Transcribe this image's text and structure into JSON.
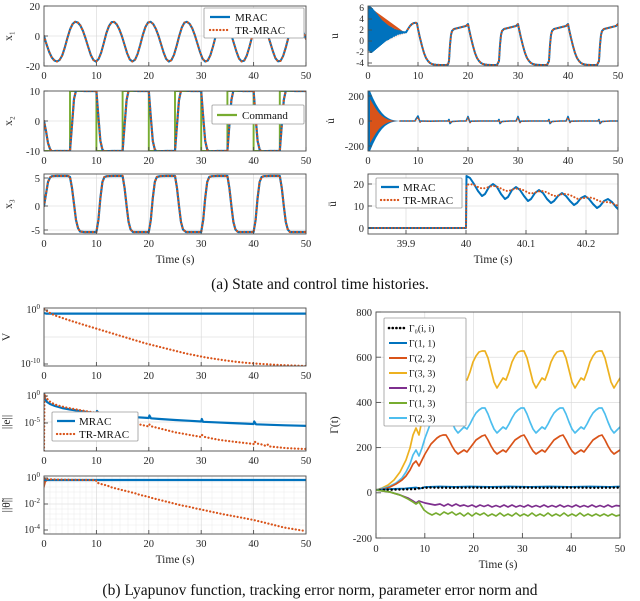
{
  "figure": {
    "caption_a": "(a) State and control time histories.",
    "caption_b": "(b) Lyapunov function, tracking error norm, parameter error norm and"
  },
  "colors": {
    "mrac_blue": "#0072BD",
    "trmrac_orange": "#D95319",
    "command_green": "#77AC30",
    "yellow": "#EDB120",
    "purple": "#7E2F8E",
    "green": "#77AC30",
    "lightblue": "#4DBEEE",
    "black": "#000000",
    "axis": "#4d4d4d",
    "grid": "#d6d6d6"
  },
  "legends": {
    "mrac": "MRAC",
    "trmrac": "TR-MRAC",
    "command": "Command",
    "gamma0": "Γ₀(i, i)",
    "g11": "Γ(1, 1)",
    "g22": "Γ(2, 2)",
    "g33": "Γ(3, 3)",
    "g12": "Γ(1, 2)",
    "g13": "Γ(1, 3)",
    "g23": "Γ(2, 3)"
  },
  "axis_labels": {
    "time": "Time (s)",
    "x1": "x₁",
    "x2": "x₂",
    "x3": "x₃",
    "u": "u",
    "udot": "u̇",
    "uddot": "ü",
    "V": "V",
    "enorm": "||e||",
    "thetanorm": "||θ̃||",
    "gamma_t": "Γ(t)"
  },
  "chart_data": [
    {
      "id": "x1",
      "type": "line",
      "title": "",
      "xlabel": "",
      "ylabel": "x1",
      "xlim": [
        0,
        50
      ],
      "ylim": [
        -20,
        20
      ],
      "xticks": [
        0,
        10,
        20,
        30,
        40,
        50
      ],
      "yticks": [
        -20,
        0,
        20
      ],
      "grid": true,
      "legend": [
        "MRAC",
        "TR-MRAC"
      ],
      "legend_position": "top-right",
      "series": [
        {
          "name": "MRAC",
          "color": "#0072BD",
          "style": "solid",
          "x": [
            0,
            1,
            2,
            3,
            4,
            5,
            6,
            7,
            8,
            9,
            10,
            11,
            12,
            13,
            14,
            15,
            16,
            17,
            18,
            19,
            20,
            21,
            22,
            23,
            24,
            25,
            26,
            27,
            28,
            29,
            30,
            31,
            32,
            33,
            34,
            35,
            36,
            37,
            38,
            39,
            40,
            41,
            42,
            43,
            44,
            45,
            46,
            47,
            48,
            49,
            50
          ],
          "y": [
            0,
            -6,
            -11,
            -14,
            -15,
            -15,
            -12,
            -5,
            4,
            11,
            13.5,
            12,
            8,
            2,
            -6,
            -13.5,
            -14.5,
            -12.5,
            -8,
            -1,
            12,
            13,
            11,
            6,
            -2,
            -11,
            -14.5,
            -14,
            -10,
            -4,
            13,
            13.5,
            12,
            8,
            1.5,
            -12,
            -14,
            -13.5,
            -11,
            -5.5,
            1,
            12.5,
            13,
            12,
            8,
            -11.5,
            -14,
            -13.5,
            -12,
            -7,
            12
          ]
        },
        {
          "name": "TR-MRAC",
          "color": "#D95319",
          "style": "dotted",
          "x": [
            0,
            1,
            2,
            3,
            4,
            5,
            6,
            7,
            8,
            9,
            10,
            11,
            12,
            13,
            14,
            15,
            16,
            17,
            18,
            19,
            20,
            21,
            22,
            23,
            24,
            25,
            26,
            27,
            28,
            29,
            30,
            31,
            32,
            33,
            34,
            35,
            36,
            37,
            38,
            39,
            40,
            41,
            42,
            43,
            44,
            45,
            46,
            47,
            48,
            49,
            50
          ],
          "y": [
            0,
            -6,
            -11,
            -14,
            -15,
            -15,
            -12,
            -5,
            4,
            11,
            13.5,
            12,
            8,
            2,
            -6,
            -13.5,
            -14.5,
            -12.5,
            -8,
            -1,
            12,
            13,
            11,
            6,
            -2,
            -11,
            -14.5,
            -14,
            -10,
            -4,
            13,
            13.5,
            12,
            8,
            1.5,
            -12,
            -14,
            -13.5,
            -11,
            -5.5,
            1,
            12.5,
            13,
            12,
            8,
            -11.5,
            -14,
            -13.5,
            -12,
            -7,
            12
          ]
        }
      ]
    },
    {
      "id": "x2",
      "type": "line",
      "ylabel": "x2",
      "xlim": [
        0,
        50
      ],
      "ylim": [
        -10,
        10
      ],
      "xticks": [
        0,
        10,
        20,
        30,
        40,
        50
      ],
      "yticks": [
        -10,
        0,
        10
      ],
      "grid": true,
      "legend": [
        "Command"
      ],
      "legend_position": "right",
      "description": "square-wave command between -10 and +10 with 5 s half period; MRAC and TR-MRAC track it with slight rounding."
    },
    {
      "id": "x3",
      "type": "line",
      "ylabel": "x3",
      "xlabel": "Time (s)",
      "xlim": [
        0,
        50
      ],
      "ylim": [
        -5,
        5
      ],
      "xticks": [
        0,
        10,
        20,
        30,
        40,
        50
      ],
      "yticks": [
        -5,
        0,
        5
      ],
      "grid": true,
      "description": "square-wave-like response alternating between about +5.6 and -5.4 every 5 s."
    },
    {
      "id": "u",
      "type": "line",
      "ylabel": "u",
      "xlim": [
        0,
        50
      ],
      "ylim": [
        -5,
        7
      ],
      "xticks": [
        0,
        10,
        20,
        30,
        40,
        50
      ],
      "yticks": [
        -4,
        -2,
        0,
        2,
        4,
        6
      ],
      "grid": true,
      "description": "control input: large chattering band in first 5 s reaching 6.5, then sawtooth cycles rising to about 5 and dropping to -4 every 10 s."
    },
    {
      "id": "udot",
      "type": "line",
      "ylabel": "udot",
      "xlim": [
        0,
        50
      ],
      "ylim": [
        -260,
        260
      ],
      "xticks": [
        0,
        10,
        20,
        30,
        40,
        50
      ],
      "yticks": [
        -200,
        0,
        200
      ],
      "grid": true,
      "description": "control rate: decaying high-frequency envelope from +-230 at t=0 to near zero by t=4, then small spikes at each command switch."
    },
    {
      "id": "uddot",
      "type": "line",
      "ylabel": "uddot",
      "xlabel": "Time (s)",
      "xlim": [
        39.85,
        40.26
      ],
      "ylim": [
        -2,
        25
      ],
      "xticks": [
        39.9,
        40,
        40.1,
        40.2
      ],
      "yticks": [
        0,
        10,
        20
      ],
      "grid": true,
      "legend": [
        "MRAC",
        "TR-MRAC"
      ],
      "legend_position": "left",
      "description": "zoomed view: flat at 0 until t=40, then jump to 23 (MRAC) / 19 (TR-MRAC) with decaying oscillation to about 10 by 40.25."
    },
    {
      "id": "V",
      "type": "line",
      "ylabel": "V",
      "yscale": "log",
      "xlim": [
        0,
        50
      ],
      "ylim": [
        1e-11,
        3
      ],
      "xticks": [
        0,
        10,
        20,
        30,
        40,
        50
      ],
      "yticks_labels": [
        "10^0",
        "10^-10"
      ],
      "grid": true,
      "series": [
        {
          "name": "MRAC",
          "color": "#0072BD",
          "style": "solid",
          "description": "flat near 0.4 for all time"
        },
        {
          "name": "TR-MRAC",
          "color": "#D95319",
          "style": "dotted",
          "description": "decays log-linearly from 1 to about 1e-10 at t=50"
        }
      ]
    },
    {
      "id": "e_norm",
      "type": "line",
      "ylabel": "||e||",
      "yscale": "log",
      "xlim": [
        0,
        50
      ],
      "ylim": [
        1e-08,
        3
      ],
      "xticks": [
        0,
        10,
        20,
        30,
        40,
        50
      ],
      "yticks_labels": [
        "10^0",
        "10^-5"
      ],
      "grid": true,
      "legend": [
        "MRAC",
        "TR-MRAC"
      ],
      "legend_position": "left",
      "series": [
        {
          "name": "MRAC",
          "color": "#0072BD",
          "style": "solid",
          "description": "decays from 1e-1 to about 1e-3 with sawtooth bumps at each switch"
        },
        {
          "name": "TR-MRAC",
          "color": "#D95319",
          "style": "dotted",
          "description": "decays from 1 to about 1e-7 with sawtooth bumps"
        }
      ]
    },
    {
      "id": "theta_norm",
      "type": "line",
      "ylabel": "||theta_tilde||",
      "xlabel": "Time (s)",
      "yscale": "log",
      "xlim": [
        0,
        50
      ],
      "ylim": [
        0.0001,
        3
      ],
      "xticks": [
        0,
        10,
        20,
        30,
        40,
        50
      ],
      "yticks_labels": [
        "10^0",
        "10^-2",
        "10^-4"
      ],
      "grid": true,
      "series": [
        {
          "name": "MRAC",
          "color": "#0072BD",
          "style": "solid",
          "description": "flat near 0.35"
        },
        {
          "name": "TR-MRAC",
          "color": "#D95319",
          "style": "dotted",
          "description": "flat near 0.4 until t=10 then decays to about 1.3e-4 at t=50"
        }
      ]
    },
    {
      "id": "gamma",
      "type": "line",
      "ylabel": "Gamma(t)",
      "xlabel": "Time (s)",
      "xlim": [
        0,
        50
      ],
      "ylim": [
        -200,
        800
      ],
      "xticks": [
        0,
        10,
        20,
        30,
        40,
        50
      ],
      "yticks": [
        -200,
        0,
        200,
        400,
        600,
        800
      ],
      "grid": true,
      "legend": [
        "Γ0(i,i)",
        "Γ(1,1)",
        "Γ(2,2)",
        "Γ(3,3)",
        "Γ(1,2)",
        "Γ(1,3)",
        "Γ(2,3)"
      ],
      "legend_position": "top-left",
      "series": [
        {
          "name": "Γ0(i,i)",
          "color": "#000000",
          "style": "dotted",
          "approx_value": 12
        },
        {
          "name": "Γ(1,1)",
          "color": "#0072BD",
          "style": "solid",
          "approx_value": 14
        },
        {
          "name": "Γ(2,2)",
          "color": "#D95319",
          "style": "solid",
          "peak": 270,
          "trough": 150
        },
        {
          "name": "Γ(3,3)",
          "color": "#EDB120",
          "style": "solid",
          "peak": 730,
          "trough": 390
        },
        {
          "name": "Γ(1,2)",
          "color": "#7E2F8E",
          "style": "solid",
          "approx_value": -42
        },
        {
          "name": "Γ(1,3)",
          "color": "#77AC30",
          "style": "solid",
          "approx_value": -62
        },
        {
          "name": "Γ(2,3)",
          "color": "#4DBEEE",
          "style": "solid",
          "peak": 437,
          "trough": 250
        }
      ]
    }
  ]
}
